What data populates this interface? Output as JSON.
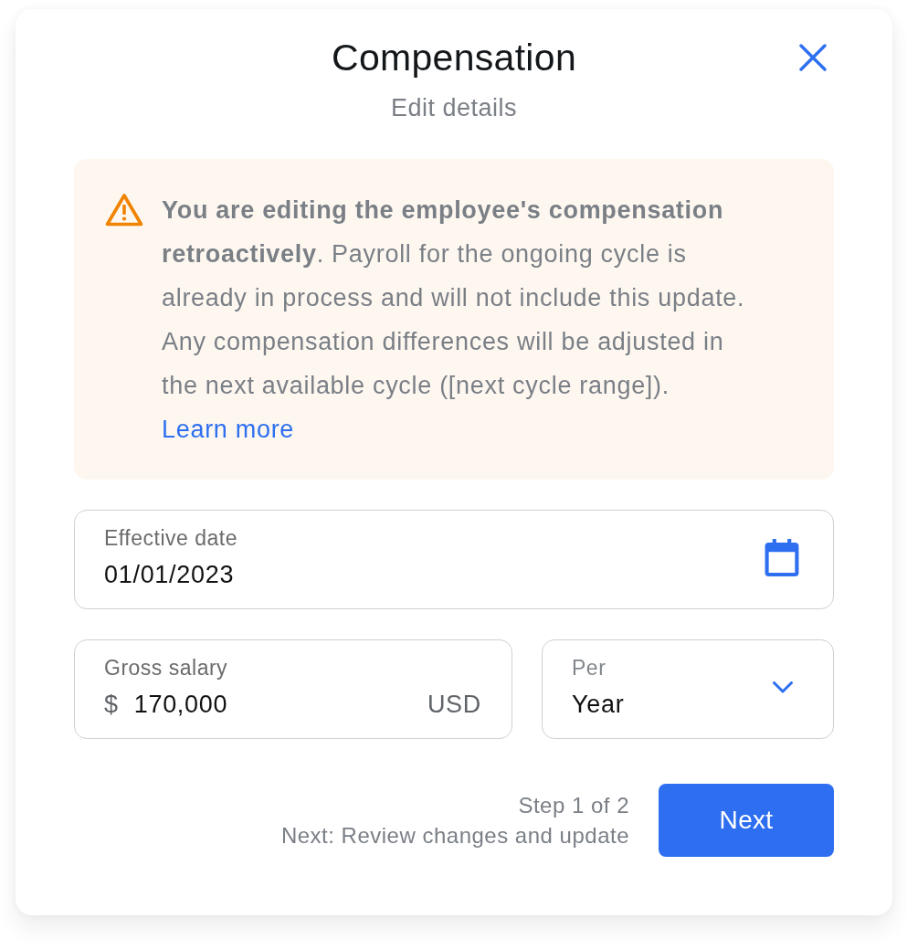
{
  "dialog": {
    "title": "Compensation",
    "subtitle": "Edit details"
  },
  "alert": {
    "kind": "warning",
    "text": "**You are editing the employee's compensation retroactively**. Payroll for the ongoing cycle is already in process and will not include this update. Any compensation differences will be adjusted in the next available cycle ([next cycle range]).",
    "link": "Learn more"
  },
  "fields": [
    {
      "kind": "date",
      "label": "Effective date",
      "value": "01/01/2023"
    },
    {
      "kind": "money",
      "label": "Gross salary",
      "prefix": "$",
      "value": "170,000",
      "suffix": "USD"
    },
    {
      "kind": "select",
      "label": "Per",
      "value": "Year"
    }
  ],
  "footer": {
    "step": "Step 1 of 2",
    "hint": "Next: Review changes and update",
    "button": "Next"
  }
}
